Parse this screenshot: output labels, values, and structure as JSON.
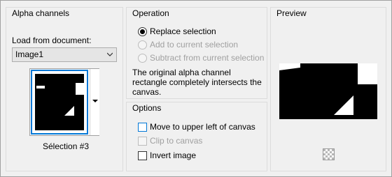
{
  "alpha_panel": {
    "title": "Alpha channels",
    "load_label": "Load from document:",
    "document_value": "Image1",
    "thumbnail_caption": "Sélection #3"
  },
  "operation_panel": {
    "title": "Operation",
    "options": [
      {
        "label": "Replace selection",
        "selected": true,
        "enabled": true
      },
      {
        "label": "Add to current selection",
        "selected": false,
        "enabled": false
      },
      {
        "label": "Subtract from current selection",
        "selected": false,
        "enabled": false
      }
    ],
    "description": "The original alpha channel rectangle completely intersects the canvas."
  },
  "options_panel": {
    "title": "Options",
    "checks": [
      {
        "label": "Move to upper left of canvas",
        "checked": false,
        "enabled": true
      },
      {
        "label": "Clip to canvas",
        "checked": false,
        "enabled": false
      },
      {
        "label": "Invert image",
        "checked": false,
        "enabled": true
      }
    ]
  },
  "preview_panel": {
    "title": "Preview",
    "checker_icon": "checkerboard-icon"
  },
  "colors": {
    "accent": "#0078d7",
    "panel_bg": "#f0f0f0",
    "disabled_text": "#a0a0a0"
  }
}
